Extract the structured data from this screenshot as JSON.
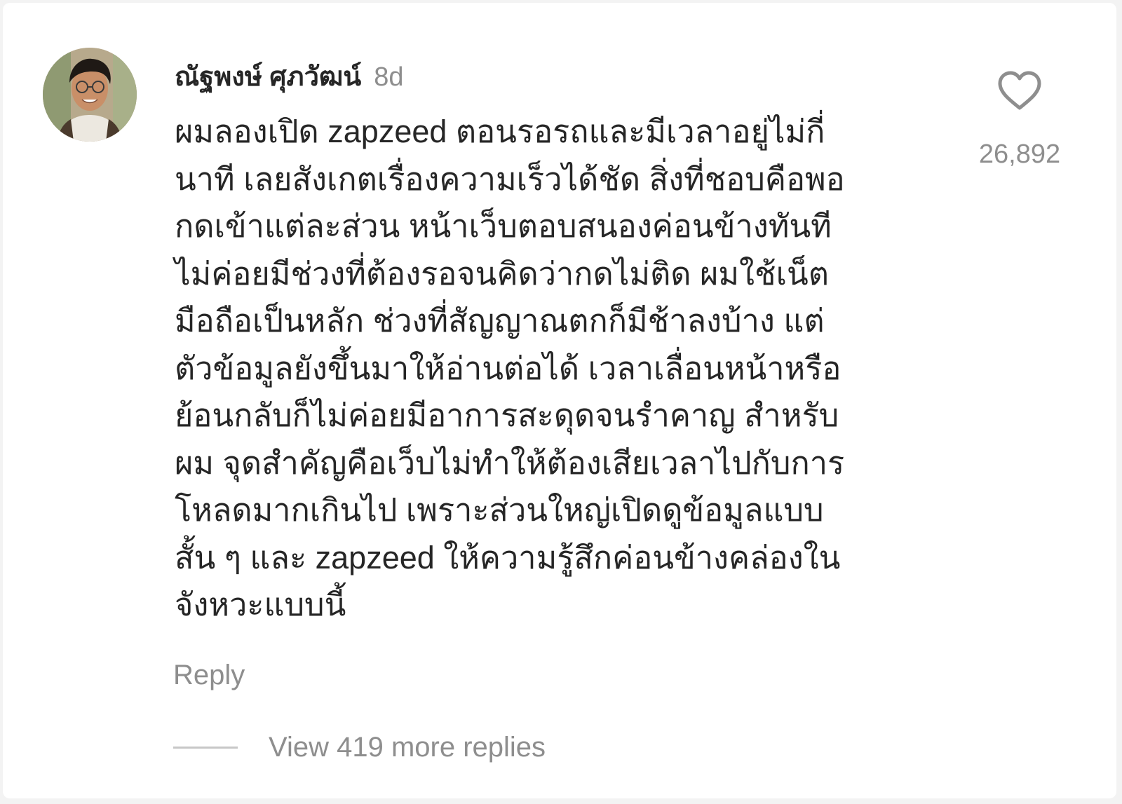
{
  "comment": {
    "username": "ณัฐพงษ์ ศุภวัฒน์",
    "time_ago": "8d",
    "avatar_icon": "user-avatar",
    "text": "ผมลองเปิด zapzeed ตอนรอรถและมีเวลาอยู่ไม่กี่\nนาที เลยสังเกตเรื่องความเร็วได้ชัด สิ่งที่ชอบคือพอ\nกดเข้าแต่ละส่วน หน้าเว็บตอบสนองค่อนข้างทันที\nไม่ค่อยมีช่วงที่ต้องรอจนคิดว่ากดไม่ติด ผมใช้เน็ต\nมือถือเป็นหลัก ช่วงที่สัญญาณตกก็มีช้าลงบ้าง แต่\nตัวข้อมูลยังขึ้นมาให้อ่านต่อได้ เวลาเลื่อนหน้าหรือ\nย้อนกลับก็ไม่ค่อยมีอาการสะดุดจนรำคาญ สำหรับ\nผม จุดสำคัญคือเว็บไม่ทำให้ต้องเสียเวลาไปกับการ\nโหลดมากเกินไป เพราะส่วนใหญ่เปิดดูข้อมูลแบบ\nสั้น ๆ และ zapzeed ให้ความรู้สึกค่อนข้างคล่องใน\nจังหวะแบบนี้",
    "like_icon": "heart-icon",
    "like_count": "26,892",
    "reply_label": "Reply",
    "view_replies_label": "View 419 more replies"
  },
  "colors": {
    "text_primary": "#262626",
    "text_secondary": "#8e8e8e",
    "divider": "#c7c7c7",
    "background": "#ffffff"
  }
}
